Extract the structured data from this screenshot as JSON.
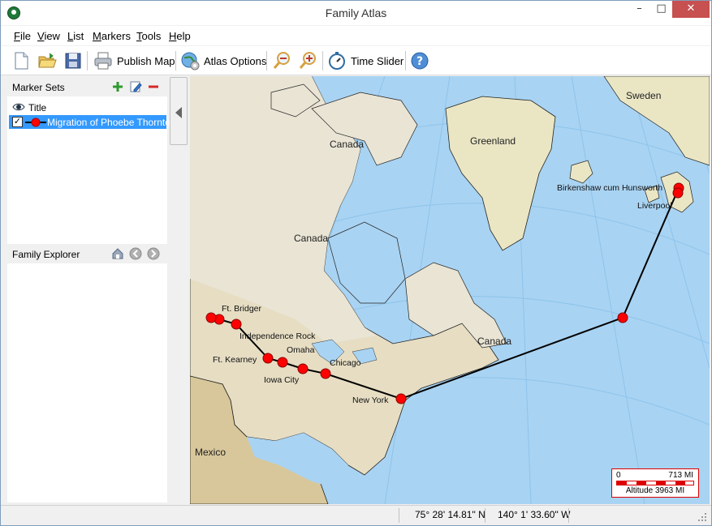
{
  "window": {
    "title": "Family Atlas"
  },
  "menu": [
    "File",
    "View",
    "List",
    "Markers",
    "Tools",
    "Help"
  ],
  "toolbar": {
    "publish_label": "Publish Map",
    "atlas_options_label": "Atlas Options",
    "time_slider_label": "Time Slider"
  },
  "marker_sets": {
    "header": "Marker Sets",
    "items": [
      {
        "label": "Title"
      },
      {
        "label": "Migration of Phoebe Thornton",
        "checked": true
      }
    ]
  },
  "family_explorer": {
    "header": "Family Explorer"
  },
  "map": {
    "labels": {
      "canada_north": "Canada",
      "greenland": "Greenland",
      "sweden": "Sweden",
      "canada_main": "Canada",
      "canada_east": "Canada",
      "mexico": "Mexico"
    },
    "places": {
      "birkenshaw": "Birkenshaw cum Hunsworth",
      "liverpool": "Liverpool",
      "ft_bridger": "Ft. Bridger",
      "independence_rock": "Independence Rock",
      "omaha": "Omaha",
      "ft_kearney": "Ft. Kearney",
      "iowa_city": "Iowa City",
      "chicago": "Chicago",
      "new_york": "New York"
    },
    "route_color": "#000000",
    "marker_color": "#ff0000",
    "scale": {
      "zero": "0",
      "distance": "713 MI",
      "altitude": "Altitude 3963 MI"
    }
  },
  "status": {
    "latitude": "75° 28' 14.81\" N",
    "longitude": "140° 1' 33.60\" W"
  }
}
